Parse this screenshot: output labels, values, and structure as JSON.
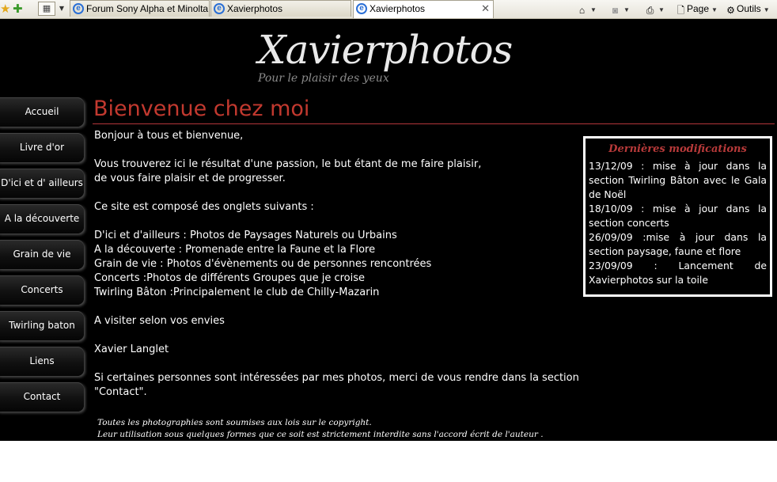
{
  "browser": {
    "tabs": [
      {
        "label": "Forum Sony Alpha et Minolta ...",
        "active": false
      },
      {
        "label": "Xavierphotos",
        "active": false
      },
      {
        "label": "Xavierphotos",
        "active": true
      }
    ],
    "toolbar": {
      "page_label": "Page",
      "tools_label": "Outils"
    }
  },
  "site": {
    "logo_title": "Xavierphotos",
    "logo_tagline": "Pour le plaisir des yeux",
    "nav": [
      "Accueil",
      "Livre d'or",
      "D'ici et d' ailleurs",
      "A la découverte",
      "Grain de vie",
      "Concerts",
      "Twirling baton",
      "Liens",
      "Contact"
    ],
    "heading": "Bienvenue chez moi",
    "content": {
      "greeting": "Bonjour à tous et bienvenue,",
      "intro_line1": "Vous trouverez ici le résultat d'une passion, le but étant de me faire plaisir,",
      "intro_line2": "de vous faire plaisir et de progresser.",
      "tabs_intro": "Ce site est composé des onglets suivants :",
      "sections": [
        "D'ici et d'ailleurs : Photos de Paysages Naturels ou Urbains",
        "A la découverte : Promenade entre la Faune et la Flore",
        "Grain de vie : Photos d'évènements ou de personnes rencontrées",
        "Concerts :Photos de différents Groupes que je croise",
        "Twirling Bâton :Principalement le club de Chilly-Mazarin"
      ],
      "visit": "A visiter selon vos envies",
      "author": "Xavier Langlet",
      "contact_line1": "Si certaines personnes sont intéressées par mes photos, merci de vous rendre dans la section",
      "contact_line2": "\"Contact\"."
    },
    "copyright_line1": "Toutes les photographies sont soumises aux lois sur le copyright.",
    "copyright_line2": "Leur utilisation sous quelques formes que ce soit est strictement interdite sans l'accord écrit de l'auteur .",
    "updates": {
      "title": "Dernières modifications",
      "items": [
        "13/12/09 : mise à jour dans la section Twirling Bâton avec le Gala de Noël",
        "18/10/09 : mise à jour dans la section concerts",
        "26/09/09 :mise à jour dans la section paysage, faune et flore",
        "23/09/09 : Lancement de Xavierphotos sur la toile"
      ]
    }
  }
}
